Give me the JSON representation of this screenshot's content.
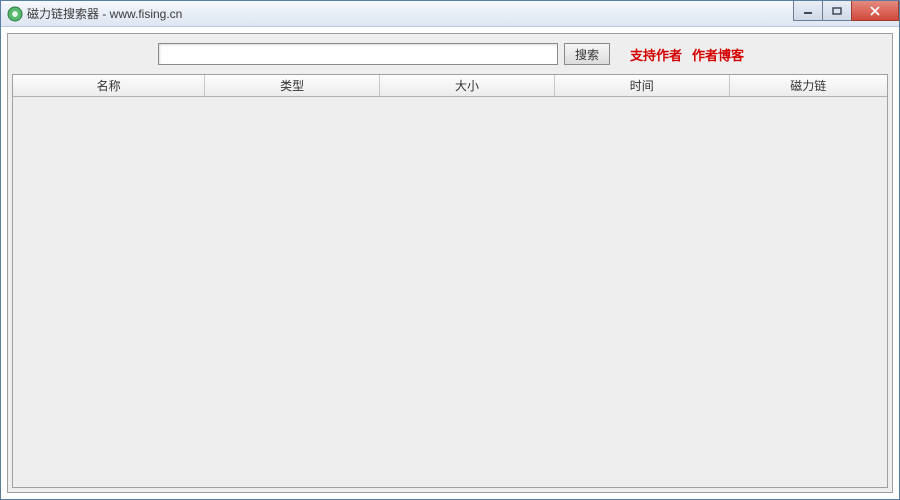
{
  "window": {
    "title": "磁力链搜索器 - www.fising.cn"
  },
  "search": {
    "value": "",
    "placeholder": "",
    "button_label": "搜索"
  },
  "links": {
    "support_author": "支持作者",
    "author_blog": "作者博客"
  },
  "table": {
    "headers": {
      "name": "名称",
      "type": "类型",
      "size": "大小",
      "time": "时间",
      "magnet": "磁力链"
    },
    "rows": []
  }
}
